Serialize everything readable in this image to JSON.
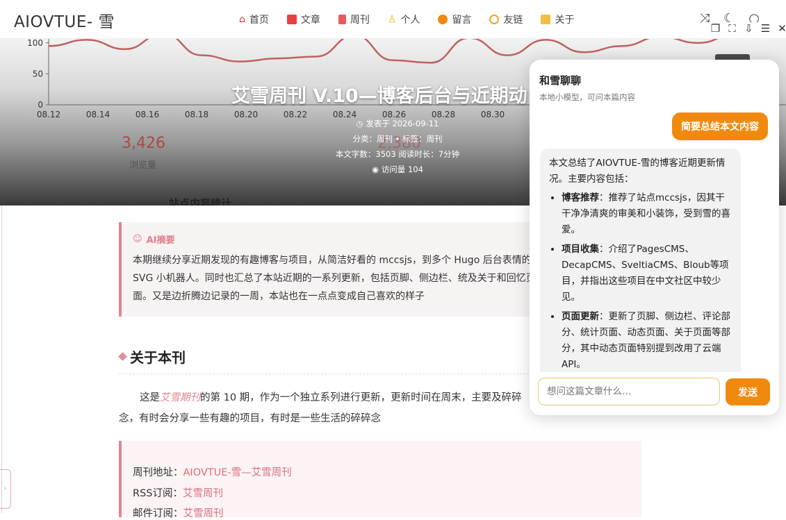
{
  "nav": {
    "site_title": "AIOVTUE- 雪",
    "menu": [
      {
        "label": "首页",
        "icon": "home-icon",
        "color": "#d63031"
      },
      {
        "label": "文章",
        "icon": "book-icon",
        "color": "#e84040"
      },
      {
        "label": "周刊",
        "icon": "document-icon",
        "color": "#e85a5a"
      },
      {
        "label": "个人",
        "icon": "person-icon",
        "color": "#f0b020"
      },
      {
        "label": "留言",
        "icon": "chat-icon",
        "color": "#f08a0e"
      },
      {
        "label": "友链",
        "icon": "globe-icon",
        "color": "#f0a020"
      },
      {
        "label": "关于",
        "icon": "info-icon",
        "color": "#f0c040"
      }
    ],
    "right_icons": [
      "shuffle-icon",
      "moon-icon",
      "search-icon"
    ]
  },
  "window_controls": [
    "restore-icon",
    "fullscreen-icon",
    "download-icon",
    "menu-icon",
    "close-icon"
  ],
  "hero": {
    "title": "艾雪周刊 V.10—博客后台与近期动",
    "published": "发表于 2026-09-11",
    "category": "分类：周刊 • 标签：周刊",
    "word_count": "本文字数：3503  阅读时长：7分钟",
    "views": "访问量 104",
    "stat_value": "3,426",
    "stat_label": "浏览量",
    "stat_value2": "2,380",
    "section_label": "站点内容统计"
  },
  "chart_data": {
    "type": "line",
    "categories": [
      "08.12",
      "08.14",
      "08.16",
      "08.18",
      "08.20",
      "08.22",
      "08.24",
      "08.26",
      "08.28",
      "08.30"
    ],
    "y_ticks": [
      "100",
      "50",
      "0"
    ],
    "series": [
      {
        "values": [
          95,
          105,
          90,
          115,
          80,
          70,
          75,
          78,
          112,
          72,
          68,
          108,
          80,
          105,
          85,
          95,
          110,
          100,
          115
        ]
      }
    ],
    "ylim": [
      0,
      120
    ],
    "color": "#c06060"
  },
  "article": {
    "ai_title": "AI摘要",
    "ai_text": "本期继续分享近期发现的有趣博客与项目，从简洁好看的 mccsjs，到多个 Hugo 后台表情的 SVG 小机器人。同时也汇总了本站近期的一系列更新，包括页脚、侧边栏、统及关于和回忆页面。又是边折腾边记录的一周，本站也在一点点变成自己喜欢的样子",
    "section_title": "关于本刊",
    "para_prefix": "这是",
    "para_link": "艾雪期刊",
    "para_suffix": "的第 10 期，作为一个独立系列进行更新，更新时间在周末，主要及碎碎念，有时会分享一些有趣的项目，有时是一些生活的碎碎念",
    "info": [
      {
        "label": "周刊地址：",
        "value": "AIOVTUE-雪—艾雪周刊"
      },
      {
        "label": "RSS订阅：",
        "value": "艾雪周刊"
      },
      {
        "label": "邮件订阅：",
        "value": "艾雪周刊"
      }
    ]
  },
  "chat": {
    "title": "和雪聊聊",
    "subtitle": "本地小模型，可问本篇内容",
    "user_message": "简要总结本文内容",
    "bot_intro": "本文总结了AIOVTUE-雪的博客近期更新情况。主要内容包括：",
    "bot_items": [
      {
        "bold": "博客推荐",
        "text": "：推荐了站点mccsjs，因其干干净净清爽的审美和小装饰，受到雪的喜爱。"
      },
      {
        "bold": "项目收集",
        "text": "：介绍了PagesCMS、DecapCMS、SveltiaCMS、Bloub等项目，并指出这些项目在中文社区中较少见。"
      },
      {
        "bold": "页面更新",
        "text": "：更新了页脚、侧边栏、评论部分、统计页面、动态页面、关于页面等部分，其中动态页面特别提到改用了云端API。"
      }
    ],
    "input_placeholder": "想问这篇文章什么…",
    "send_label": "发送",
    "accent": "#f08a0e"
  }
}
